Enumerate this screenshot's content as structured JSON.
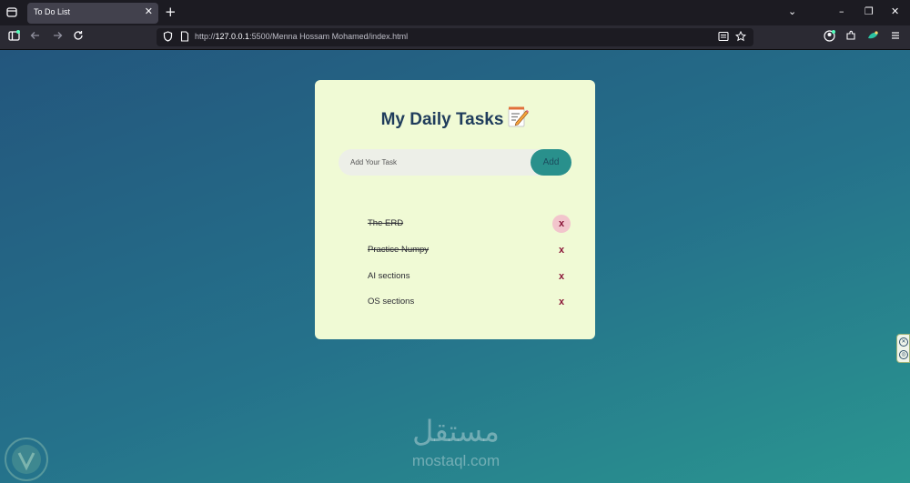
{
  "browser": {
    "tab": {
      "title": "To Do List",
      "close_glyph": "✕"
    },
    "new_tab_glyph": "+",
    "url": {
      "host": "127.0.0.1",
      "rest": ":5500/Menna Hossam Mohamed/index.html",
      "prefix": "http://"
    },
    "window_controls": {
      "list": "⌄",
      "minimize": "–",
      "restore": "❐",
      "close": "✕"
    },
    "icons": [
      "sidebar-icon",
      "back-icon",
      "forward-icon",
      "reload-icon",
      "shield-icon",
      "page-icon",
      "reader-view-icon",
      "bookmark-star-icon",
      "account-icon",
      "extensions-icon",
      "vpn-icon",
      "menu-icon"
    ]
  },
  "app": {
    "title": "My Daily Tasks",
    "input": {
      "placeholder": "Add Your Task",
      "value": ""
    },
    "add_button_label": "Add",
    "tasks": [
      {
        "label": "The ERD",
        "done": true,
        "delete_label": "x"
      },
      {
        "label": "Practice Numpy",
        "done": true,
        "delete_label": "x"
      },
      {
        "label": "AI sections",
        "done": false,
        "delete_label": "x"
      },
      {
        "label": "OS sections",
        "done": false,
        "delete_label": "x"
      }
    ]
  },
  "watermark": {
    "arabic": "مستقل",
    "latin": "mostaql.com"
  },
  "colors": {
    "card": "#f0fad5",
    "title": "#1f3c5c",
    "add_button": "#29908c",
    "delete": "#8a1538",
    "delete_hover": "#f2c5cc"
  }
}
